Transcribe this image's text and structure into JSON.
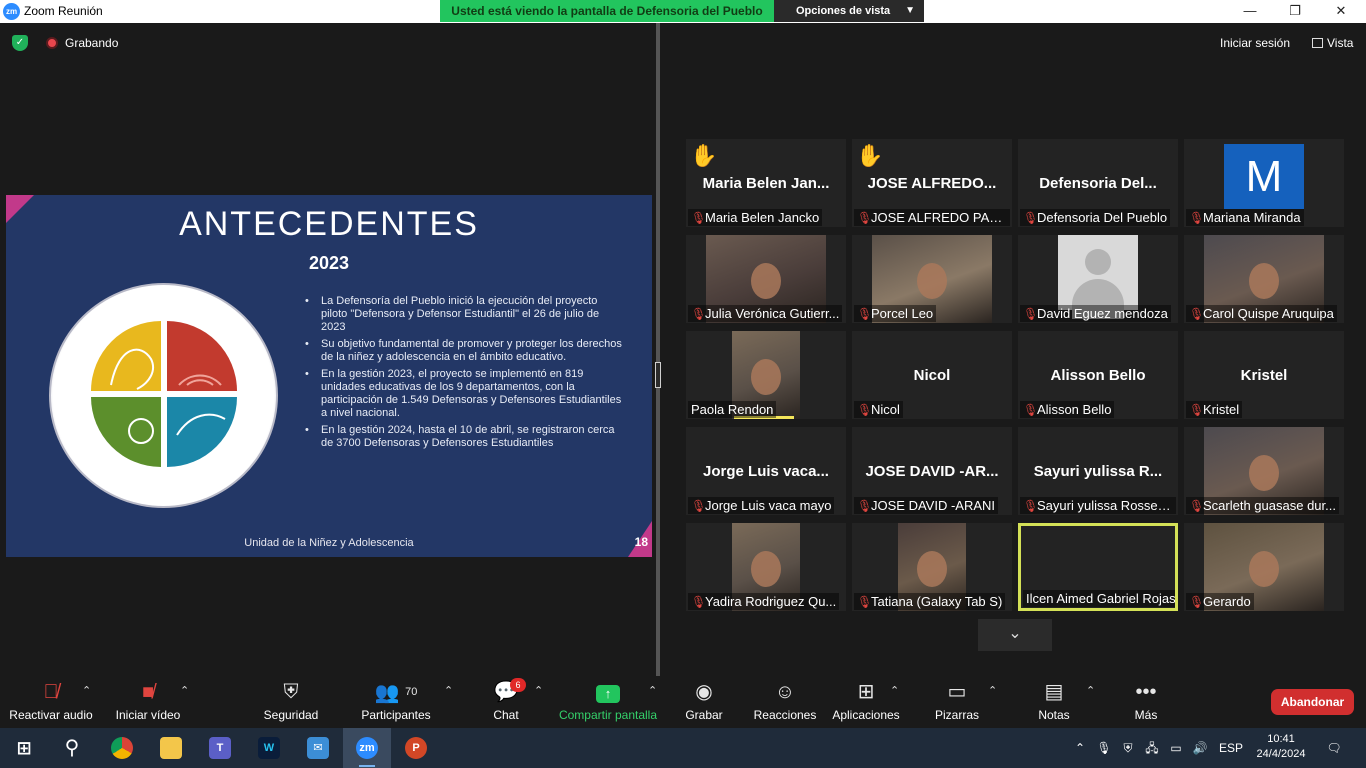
{
  "window": {
    "app_logo": "zm",
    "title": "Zoom Reunión",
    "minimize": "—",
    "maximize": "❐",
    "close": "✕"
  },
  "share_banner": {
    "text": "Usted está viendo la pantalla de Defensoria del Pueblo",
    "view_options": "Opciones de vista"
  },
  "status": {
    "recording": "Grabando",
    "sign_in": "Iniciar sesión",
    "view": "Vista"
  },
  "slide": {
    "title": "ANTECEDENTES",
    "year": "2023",
    "bullets": [
      "La Defensoría del Pueblo inició la ejecución del proyecto piloto \"Defensora y Defensor Estudiantil\" el 26 de julio de 2023",
      "Su objetivo fundamental de promover y proteger los derechos de la niñez y adolescencia en el ámbito educativo.",
      "En la gestión 2023, el proyecto se implementó en 819 unidades educativas de los 9 departamentos, con la participación de 1.549 Defensoras y Defensores Estudiantiles a nivel nacional.",
      "En la gestión 2024, hasta el 10 de abril, se registraron cerca de 3700 Defensoras y Defensores Estudiantiles"
    ],
    "footer": "Unidad de la Niñez y Adolescencia",
    "page_number": "18",
    "logo_colors": [
      "#e8b81e",
      "#c23a2e",
      "#5c8f2c",
      "#1b87a8"
    ]
  },
  "participants": [
    {
      "big_name": "Maria Belen Jan...",
      "label": "Maria Belen Jancko",
      "muted": true,
      "hand": true
    },
    {
      "big_name": "JOSE ALFREDO...",
      "label": "JOSE ALFREDO PACO...",
      "muted": true,
      "hand": true
    },
    {
      "big_name": "Defensoria Del...",
      "label": "Defensoria Del Pueblo",
      "muted": true
    },
    {
      "avatar_letter": "M",
      "label": "Mariana Miranda",
      "muted": true
    },
    {
      "video": true,
      "label": "Julia Verónica Gutierr...",
      "muted": true
    },
    {
      "video": true,
      "label": "Porcel Leo",
      "muted": true
    },
    {
      "generic_avatar": true,
      "label": "David Eguez mendoza",
      "muted": true
    },
    {
      "video": true,
      "label": "Carol Quispe Aruquipa",
      "muted": true
    },
    {
      "video": true,
      "label": "Paola Rendon",
      "muted": false,
      "speaking": true
    },
    {
      "big_name": "Nicol",
      "label": "Nicol",
      "muted": true
    },
    {
      "big_name": "Alisson Bello",
      "label": "Alisson Bello",
      "muted": true
    },
    {
      "big_name": "Kristel",
      "label": "Kristel",
      "muted": true
    },
    {
      "big_name": "Jorge Luis vaca...",
      "label": "Jorge Luis vaca mayo",
      "muted": true
    },
    {
      "big_name": "JOSE DAVID -AR...",
      "label": "JOSE DAVID -ARANI",
      "muted": true
    },
    {
      "big_name": "Sayuri yulissa R...",
      "label": "Sayuri yulissa Rossen...",
      "muted": true
    },
    {
      "video": true,
      "label": "Scarleth guasase dur...",
      "muted": true
    },
    {
      "video": true,
      "label": "Yadira Rodriguez Qu...",
      "muted": true
    },
    {
      "video": true,
      "label": "Tatiana (Galaxy Tab S)",
      "muted": true
    },
    {
      "active": true,
      "label": "Ilcen Aimed Gabriel Rojas",
      "muted": false
    },
    {
      "video": true,
      "label": "Gerardo",
      "muted": true
    }
  ],
  "toolbar": {
    "unmute": "Reactivar audio",
    "start_video": "Iniciar vídeo",
    "security": "Seguridad",
    "participants": "Participantes",
    "participants_count": "70",
    "chat": "Chat",
    "chat_badge": "6",
    "share": "Compartir pantalla",
    "record": "Grabar",
    "reactions": "Reacciones",
    "apps": "Aplicaciones",
    "whiteboards": "Pizarras",
    "notes": "Notas",
    "more": "Más",
    "leave": "Abandonar"
  },
  "taskbar": {
    "apps": [
      "start-icon",
      "search-icon",
      "chrome-icon",
      "file-explorer-icon",
      "teams-icon",
      "webex-icon",
      "outlook-icon",
      "zoom-icon",
      "powerpoint-icon"
    ],
    "lang": "ESP",
    "time": "10:41",
    "date": "24/4/2024"
  },
  "colors": {
    "accent_green": "#22c55e",
    "leave_red": "#d12f2f",
    "mic_red": "#e0453f",
    "active_border": "#d4e157"
  }
}
